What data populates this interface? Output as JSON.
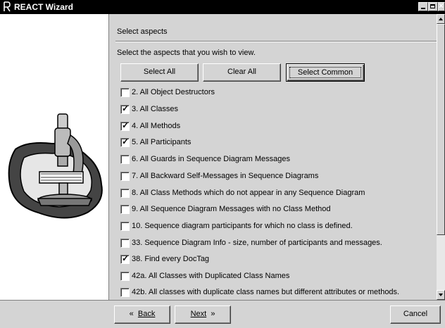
{
  "window": {
    "title": "REACT Wizard"
  },
  "section": {
    "title": "Select aspects",
    "instruction": "Select the aspects that you wish to view."
  },
  "buttons": {
    "select_all": "Select All",
    "clear_all": "Clear All",
    "select_common": "Select Common"
  },
  "aspects": [
    {
      "label": "2. All Object Destructors",
      "checked": false
    },
    {
      "label": "3. All Classes",
      "checked": true
    },
    {
      "label": "4. All Methods",
      "checked": true
    },
    {
      "label": "5. All Participants",
      "checked": true
    },
    {
      "label": "6. All Guards in Sequence Diagram Messages",
      "checked": false
    },
    {
      "label": "7. All Backward Self-Messages in Sequence Diagrams",
      "checked": false
    },
    {
      "label": "8. All Class Methods which do not appear in any Sequence Diagram",
      "checked": false
    },
    {
      "label": "9. All Sequence Diagram Messages with no Class Method",
      "checked": false
    },
    {
      "label": "10. Sequence diagram participants for which no class is defined.",
      "checked": false
    },
    {
      "label": "33. Sequence Diagram Info - size, number of participants and messages.",
      "checked": false
    },
    {
      "label": "38. Find every DocTag",
      "checked": true
    },
    {
      "label": "42a. All Classes with Duplicated Class Names",
      "checked": false
    },
    {
      "label": "42b. All classes with duplicate class names but different attributes or methods.",
      "checked": false
    }
  ],
  "footer": {
    "back": "Back",
    "next": "Next",
    "cancel": "Cancel"
  }
}
